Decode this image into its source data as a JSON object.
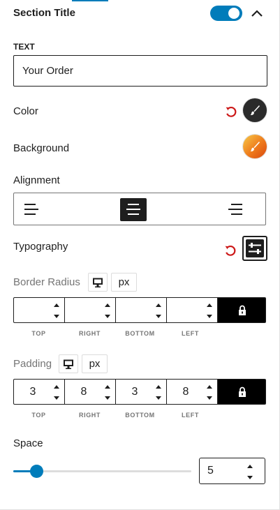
{
  "header": {
    "title": "Section Title",
    "enabled": true
  },
  "text": {
    "label": "TEXT",
    "value": "Your Order"
  },
  "color": {
    "label": "Color",
    "swatch": "#2b2b2b"
  },
  "background": {
    "label": "Background",
    "swatch_start": "#f7c948",
    "swatch_end": "#d9480f"
  },
  "alignment": {
    "label": "Alignment",
    "options": [
      "left",
      "center",
      "right"
    ],
    "selected": "center"
  },
  "typography": {
    "label": "Typography"
  },
  "border_radius": {
    "label": "Border Radius",
    "device_icon": "desktop-icon",
    "unit": "px",
    "sides": [
      {
        "label": "TOP",
        "value": ""
      },
      {
        "label": "RIGHT",
        "value": ""
      },
      {
        "label": "BOTTOM",
        "value": ""
      },
      {
        "label": "LEFT",
        "value": ""
      }
    ],
    "linked": true
  },
  "padding": {
    "label": "Padding",
    "device_icon": "desktop-icon",
    "unit": "px",
    "sides": [
      {
        "label": "TOP",
        "value": "3"
      },
      {
        "label": "RIGHT",
        "value": "8"
      },
      {
        "label": "BOTTOM",
        "value": "3"
      },
      {
        "label": "LEFT",
        "value": "8"
      }
    ],
    "linked": true
  },
  "space": {
    "label": "Space",
    "value": "5",
    "min": 0,
    "max": 100,
    "fraction": 0.13
  },
  "colors": {
    "accent": "#007cba",
    "text": "#1e1e1e",
    "muted": "#757575",
    "reset": "#cc1818"
  }
}
